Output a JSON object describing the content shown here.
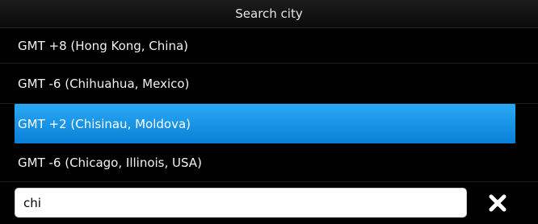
{
  "header": {
    "title": "Search city"
  },
  "results": [
    {
      "label": "GMT +8 (Hong Kong, China)",
      "selected": false
    },
    {
      "label": "GMT -6 (Chihuahua, Mexico)",
      "selected": false
    },
    {
      "label": "GMT +2 (Chisinau, Moldova)",
      "selected": true
    },
    {
      "label": "GMT -6 (Chicago, Illinois, USA)",
      "selected": false
    }
  ],
  "search": {
    "value": "chi",
    "clear_icon": "close-icon"
  },
  "colors": {
    "background": "#000000",
    "selection": "#1a95e8",
    "text": "#ffffff"
  }
}
